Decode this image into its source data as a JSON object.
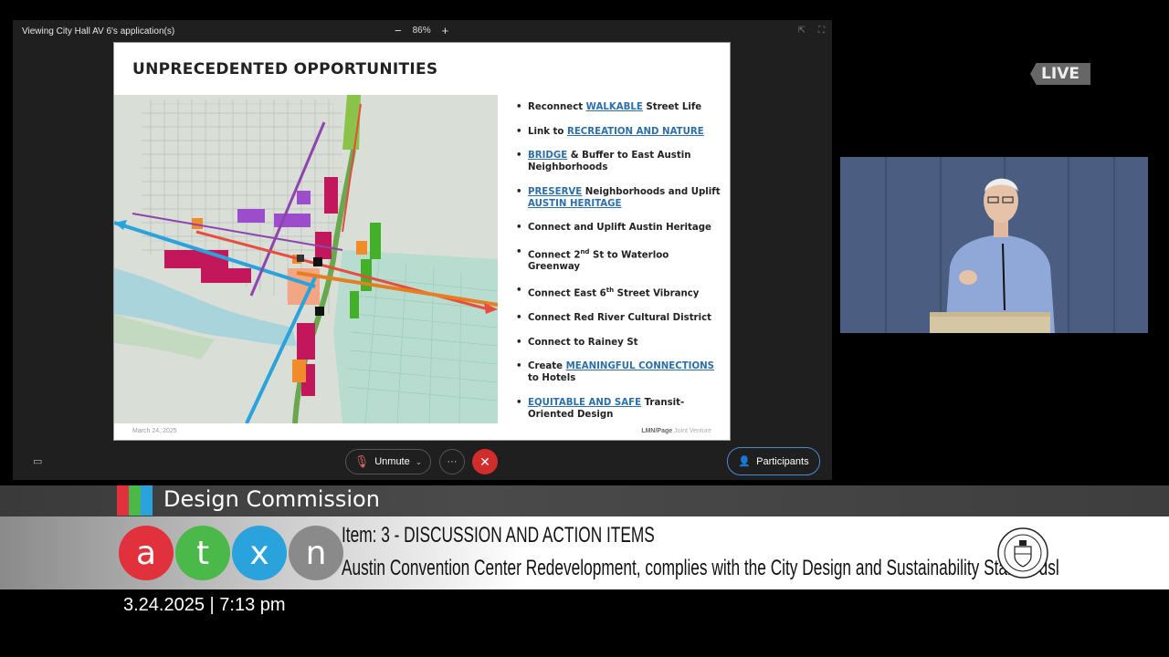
{
  "meeting": {
    "window_title": "Viewing City Hall AV 6's application(s)",
    "zoom_minus": "−",
    "zoom_level": "86%",
    "zoom_plus": "+",
    "unmute_label": "Unmute",
    "more_label": "···",
    "leave_label": "✕",
    "participants_label": "Participants"
  },
  "slide": {
    "title": "UNPRECEDENTED OPPORTUNITIES",
    "bullets": [
      {
        "pre": "Reconnect ",
        "link": "WALKABLE",
        "post": " Street Life"
      },
      {
        "pre": "Link to ",
        "link": "RECREATION AND NATURE",
        "post": ""
      },
      {
        "pre": "",
        "link": "BRIDGE",
        "post": " & Buffer to East Austin Neighborhoods"
      },
      {
        "pre": "",
        "link": "PRESERVE",
        "post": " Neighborhoods and Uplift ",
        "link2": "AUSTIN HERITAGE"
      },
      {
        "pre": "Connect and Uplift Austin Heritage",
        "link": "",
        "post": ""
      },
      {
        "pre": "Connect 2",
        "sup": "nd",
        "post": " St to Waterloo Greenway"
      },
      {
        "pre": "Connect East 6",
        "sup": "th",
        "post": " Street Vibrancy"
      },
      {
        "pre": "Connect Red River Cultural District",
        "link": "",
        "post": ""
      },
      {
        "pre": "Connect to Rainey St",
        "link": "",
        "post": ""
      },
      {
        "pre": "Create ",
        "link": "MEANINGFUL CONNECTIONS",
        "post": " to Hotels"
      },
      {
        "pre": "",
        "link": "EQUITABLE AND SAFE",
        "post": " Transit-Oriented Design"
      }
    ],
    "footer_date": "March 24, 2025",
    "footer_credit": "LMN/Page",
    "footer_credit_tail": "Joint Venture"
  },
  "live_badge": "LIVE",
  "lower_third": {
    "program": "Design Commission",
    "logo_letters": [
      "a",
      "t",
      "x",
      "n"
    ],
    "logo_colors": [
      "#e0313c",
      "#4bb84a",
      "#2aa3dc",
      "#8a8a8a"
    ],
    "tab_colors": [
      "#e0313c",
      "#4bb84a",
      "#2aa3dc"
    ],
    "item_title": "Item: 3 - DISCUSSION AND ACTION ITEMS",
    "item_desc": "Austin Convention Center Redevelopment, complies with the City Design and Sustainability Standardsl",
    "seal_text": "CITY OF AUSTIN",
    "datetime": "3.24.2025 | 7:13 pm"
  },
  "colors": {
    "link_blue": "#2e6fa8",
    "leave_red": "#d12d2d",
    "participants_border": "#4a8ad8"
  }
}
